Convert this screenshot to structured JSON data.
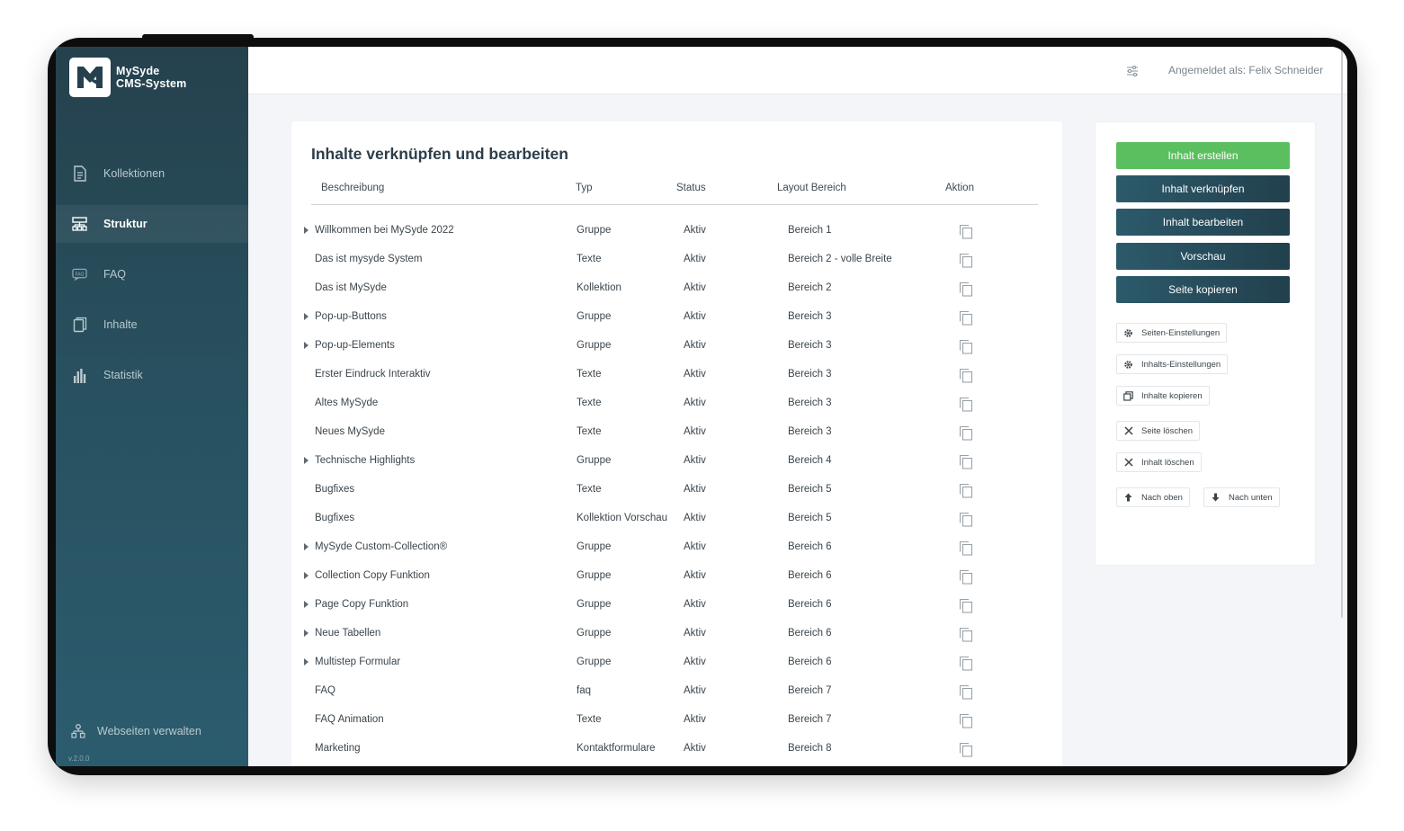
{
  "brand": {
    "line1": "MySyde",
    "line2": "CMS-System"
  },
  "sidebar": {
    "items": [
      {
        "label": "Kollektionen",
        "icon": "document-icon",
        "active": false
      },
      {
        "label": "Struktur",
        "icon": "sitemap-icon",
        "active": true
      },
      {
        "label": "FAQ",
        "icon": "faq-icon",
        "active": false
      },
      {
        "label": "Inhalte",
        "icon": "pages-icon",
        "active": false
      },
      {
        "label": "Statistik",
        "icon": "bar-chart-icon",
        "active": false
      }
    ],
    "footer_label": "Webseiten verwalten",
    "version": "v.2.0.0"
  },
  "topbar": {
    "user_label": "Angemeldet als: Felix Schneider"
  },
  "main": {
    "title": "Inhalte verknüpfen und bearbeiten",
    "columns": [
      "Beschreibung",
      "Typ",
      "Status",
      "Layout Bereich",
      "Aktion"
    ],
    "rows": [
      {
        "desc": "Willkommen bei MySyde 2022",
        "type": "Gruppe",
        "status": "Aktiv",
        "area": "Bereich 1",
        "expandable": true
      },
      {
        "desc": "Das ist mysyde System",
        "type": "Texte",
        "status": "Aktiv",
        "area": "Bereich 2 - volle Breite",
        "expandable": false
      },
      {
        "desc": "Das ist MySyde",
        "type": "Kollektion",
        "status": "Aktiv",
        "area": "Bereich 2",
        "expandable": false
      },
      {
        "desc": "Pop-up-Buttons",
        "type": "Gruppe",
        "status": "Aktiv",
        "area": "Bereich 3",
        "expandable": true
      },
      {
        "desc": "Pop-up-Elements",
        "type": "Gruppe",
        "status": "Aktiv",
        "area": "Bereich 3",
        "expandable": true
      },
      {
        "desc": "Erster Eindruck Interaktiv",
        "type": "Texte",
        "status": "Aktiv",
        "area": "Bereich 3",
        "expandable": false
      },
      {
        "desc": "Altes MySyde",
        "type": "Texte",
        "status": "Aktiv",
        "area": "Bereich 3",
        "expandable": false
      },
      {
        "desc": "Neues MySyde",
        "type": "Texte",
        "status": "Aktiv",
        "area": "Bereich 3",
        "expandable": false
      },
      {
        "desc": "Technische Highlights",
        "type": "Gruppe",
        "status": "Aktiv",
        "area": "Bereich 4",
        "expandable": true
      },
      {
        "desc": "Bugfixes",
        "type": "Texte",
        "status": "Aktiv",
        "area": "Bereich 5",
        "expandable": false
      },
      {
        "desc": "Bugfixes",
        "type": "Kollektion Vorschau",
        "status": "Aktiv",
        "area": "Bereich 5",
        "expandable": false
      },
      {
        "desc": "MySyde Custom-Collection®",
        "type": "Gruppe",
        "status": "Aktiv",
        "area": "Bereich 6",
        "expandable": true
      },
      {
        "desc": "Collection Copy Funktion",
        "type": "Gruppe",
        "status": "Aktiv",
        "area": "Bereich 6",
        "expandable": true
      },
      {
        "desc": "Page Copy Funktion",
        "type": "Gruppe",
        "status": "Aktiv",
        "area": "Bereich 6",
        "expandable": true
      },
      {
        "desc": "Neue Tabellen",
        "type": "Gruppe",
        "status": "Aktiv",
        "area": "Bereich 6",
        "expandable": true
      },
      {
        "desc": "Multistep Formular",
        "type": "Gruppe",
        "status": "Aktiv",
        "area": "Bereich 6",
        "expandable": true
      },
      {
        "desc": "FAQ",
        "type": "faq",
        "status": "Aktiv",
        "area": "Bereich 7",
        "expandable": false
      },
      {
        "desc": "FAQ Animation",
        "type": "Texte",
        "status": "Aktiv",
        "area": "Bereich 7",
        "expandable": false
      },
      {
        "desc": "Marketing",
        "type": "Kontaktformulare",
        "status": "Aktiv",
        "area": "Bereich 8",
        "expandable": false
      }
    ]
  },
  "panel": {
    "primary_buttons": [
      "Inhalt erstellen",
      "Inhalt verknüpfen",
      "Inhalt bearbeiten",
      "Vorschau",
      "Seite kopieren"
    ],
    "secondary": {
      "page_settings": "Seiten-Einstellungen",
      "content_settings": "Inhalts-Einstellungen",
      "copy_contents": "Inhalte kopieren",
      "delete_page": "Seite löschen",
      "delete_content": "Inhalt löschen",
      "move_up": "Nach oben",
      "move_down": "Nach unten"
    }
  },
  "colors": {
    "sidebar": "#28505f",
    "accent_green": "#5bbf5f",
    "button_dark": "#2c5a6b"
  }
}
